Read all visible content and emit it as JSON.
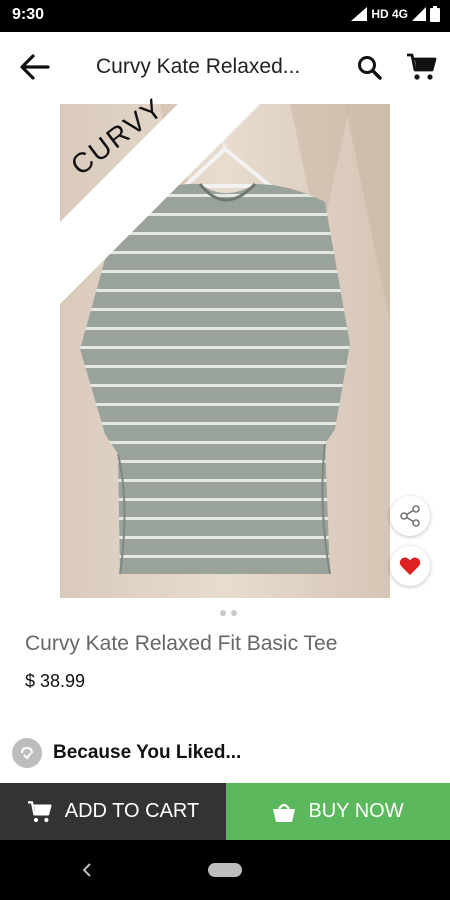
{
  "status_bar": {
    "time": "9:30",
    "network": "HD 4G"
  },
  "app_bar": {
    "title": "Curvy Kate Relaxed...",
    "back_icon": "arrow-back-icon",
    "search_icon": "search-icon",
    "cart_icon": "cart-icon"
  },
  "product": {
    "ribbon_label": "CURVY",
    "title": "Curvy Kate Relaxed Fit Basic Tee",
    "price": "$ 38.99",
    "image_pages": 2,
    "current_page": 1
  },
  "recommendations": {
    "label": "Because You Liked..."
  },
  "actions": {
    "add_to_cart": "ADD TO CART",
    "buy_now": "BUY NOW"
  },
  "colors": {
    "add_to_cart_bg": "#333333",
    "buy_now_bg": "#5cb85c",
    "favorite": "#e02020"
  }
}
